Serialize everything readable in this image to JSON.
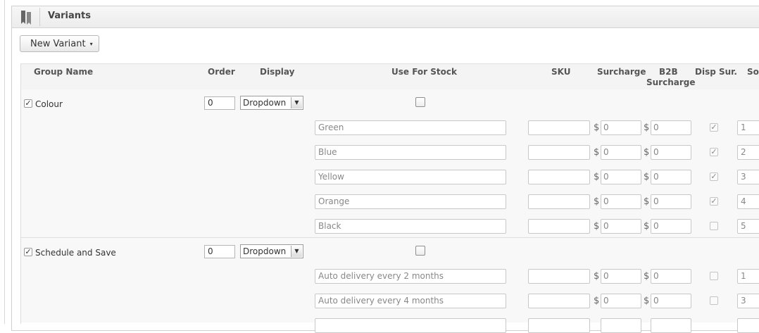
{
  "panel": {
    "title": "Variants",
    "icon": "bookmark-icon"
  },
  "toolbar": {
    "new_variant_label": "New Variant",
    "caret": "▾"
  },
  "table": {
    "headers": {
      "group_name": "Group Name",
      "order": "Order",
      "display": "Display",
      "use_for_stock": "Use For Stock",
      "sku": "SKU",
      "surcharge": "Surcharge",
      "b2b_surcharge_line1": "B2B",
      "b2b_surcharge_line2": "Surcharge",
      "disp_sur": "Disp Sur.",
      "sort": "Sor"
    },
    "currency": "$",
    "groups": [
      {
        "name": "Colour",
        "checked": true,
        "order": "0",
        "display": "Dropdown",
        "use_for_stock": false,
        "variants": [
          {
            "name": "Green",
            "sku": "",
            "surcharge": "0",
            "b2b_surcharge": "0",
            "disp_sur": true,
            "sort": "1"
          },
          {
            "name": "Blue",
            "sku": "",
            "surcharge": "0",
            "b2b_surcharge": "0",
            "disp_sur": true,
            "sort": "2"
          },
          {
            "name": "Yellow",
            "sku": "",
            "surcharge": "0",
            "b2b_surcharge": "0",
            "disp_sur": true,
            "sort": "3"
          },
          {
            "name": "Orange",
            "sku": "",
            "surcharge": "0",
            "b2b_surcharge": "0",
            "disp_sur": true,
            "sort": "4"
          },
          {
            "name": "Black",
            "sku": "",
            "surcharge": "0",
            "b2b_surcharge": "0",
            "disp_sur": false,
            "sort": "5"
          }
        ]
      },
      {
        "name": "Schedule and Save",
        "checked": true,
        "order": "0",
        "display": "Dropdown",
        "use_for_stock": false,
        "variants": [
          {
            "name": "Auto delivery every 2 months",
            "sku": "",
            "surcharge": "0",
            "b2b_surcharge": "0",
            "disp_sur": false,
            "sort": "1"
          },
          {
            "name": "Auto delivery every 4 months",
            "sku": "",
            "surcharge": "0",
            "b2b_surcharge": "0",
            "disp_sur": false,
            "sort": "3"
          }
        ]
      }
    ]
  },
  "colors": {
    "header_bg": "#f4f4f4",
    "row_bg": "#f8f8f8",
    "border": "#c8c8c8"
  }
}
